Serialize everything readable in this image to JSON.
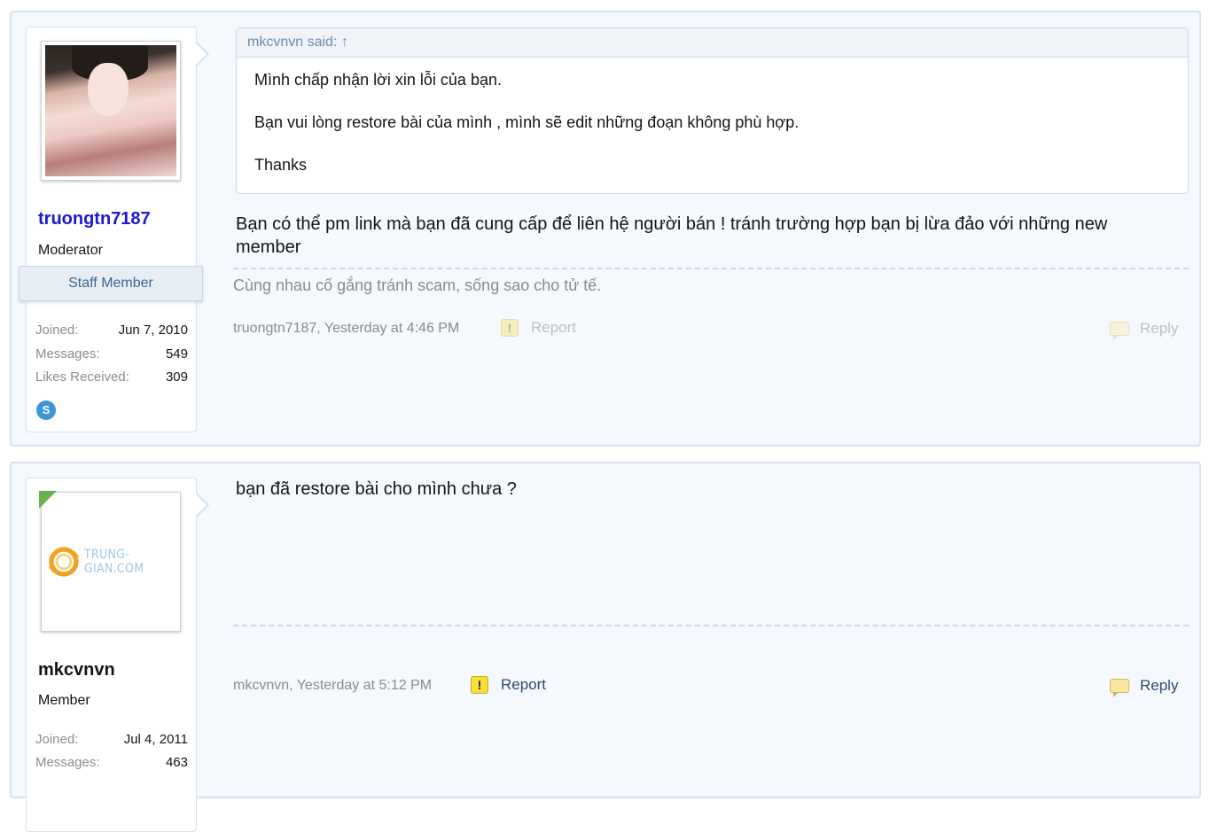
{
  "posts": [
    {
      "username": "truongtn7187",
      "user_title": "Moderator",
      "staff_badge": "Staff Member",
      "stats": [
        {
          "label": "Joined:",
          "value": "Jun 7, 2010"
        },
        {
          "label": "Messages:",
          "value": "549"
        },
        {
          "label": "Likes Received:",
          "value": "309"
        }
      ],
      "contact_icon": "skype-icon",
      "contact_glyph": "S",
      "quote": {
        "header": "mkcvnvn said: ↑",
        "lines": [
          "Mình chấp nhận lời xin lỗi của bạn.",
          "Bạn vui lòng restore bài của mình , mình sẽ edit những đoạn không phù hợp.",
          "Thanks"
        ]
      },
      "message": "Bạn có thể pm link mà bạn đã cung cấp để liên hệ người bán ! tránh trường hợp bạn bị lừa đảo với những new member",
      "signature": "Cùng nhau cố gắng tránh scam, sống sao cho tử tế.",
      "meta": "truongtn7187, Yesterday at 4:46 PM",
      "report_label": "Report",
      "reply_label": "Reply",
      "warn_glyph": "!"
    },
    {
      "username": "mkcvnvn",
      "user_title": "Member",
      "avatar_text": "TRUNG-GIAN.COM",
      "stats": [
        {
          "label": "Joined:",
          "value": "Jul 4, 2011"
        },
        {
          "label": "Messages:",
          "value": "463"
        }
      ],
      "message": "bạn đã restore bài cho mình chưa ?",
      "meta": "mkcvnvn, Yesterday at 5:12 PM",
      "report_label": "Report",
      "reply_label": "Reply",
      "warn_glyph": "!"
    }
  ],
  "colors": {
    "username_staff": "#1919d2",
    "username_member": "#141414",
    "link_active": "#2b4a6e",
    "online_corner": "#6ab04c"
  }
}
